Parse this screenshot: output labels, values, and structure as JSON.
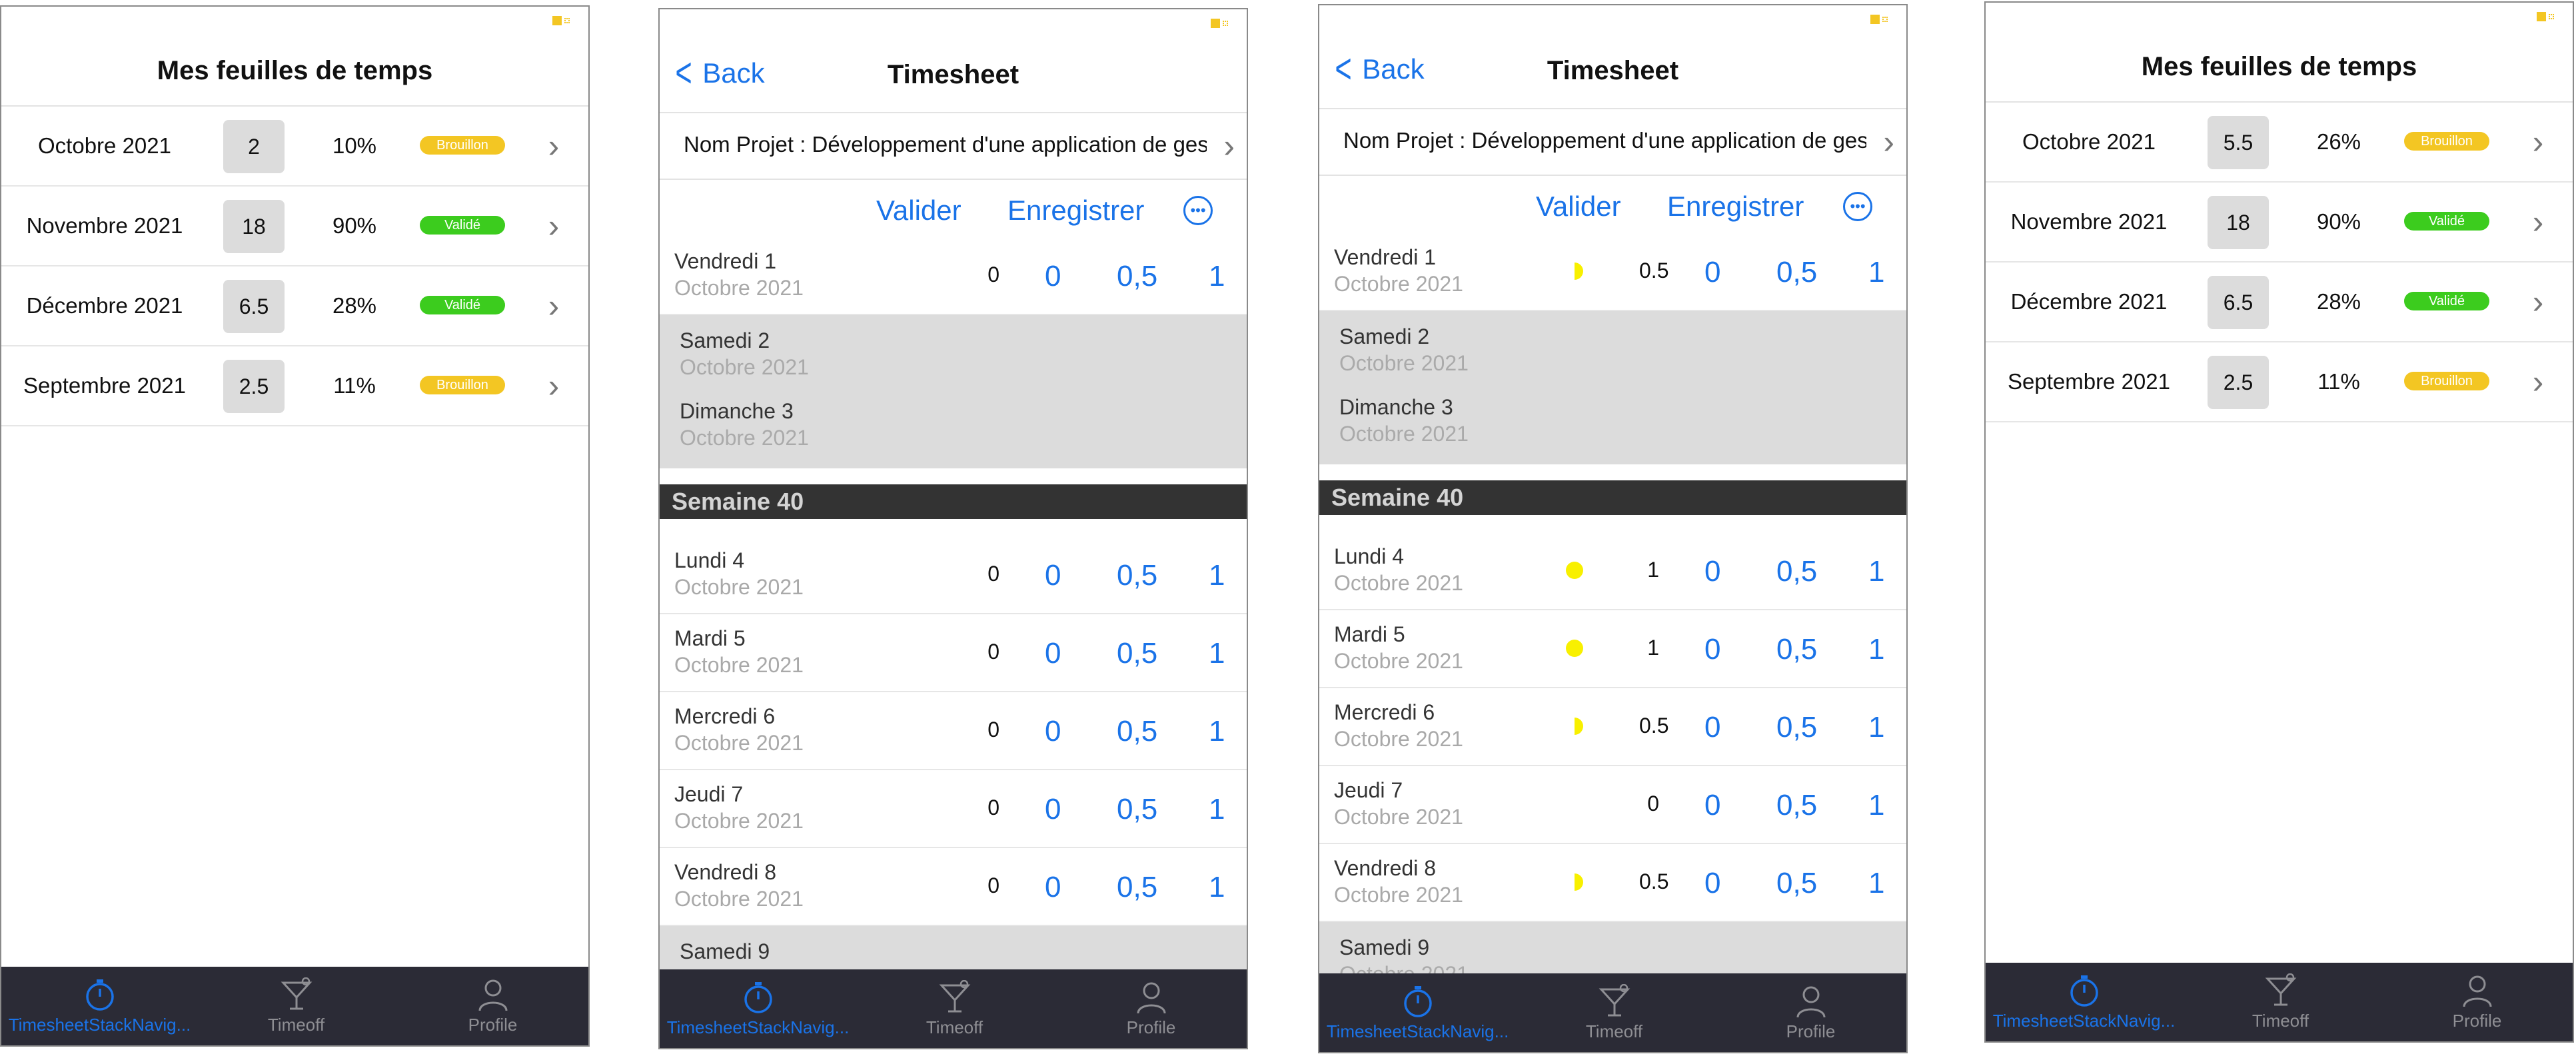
{
  "list_screen": {
    "title": "Mes feuilles de temps",
    "rows_a": [
      {
        "month": "Octobre 2021",
        "days": "2",
        "pct": "10%",
        "status": "Brouillon",
        "status_color": "#f3c623"
      },
      {
        "month": "Novembre 2021",
        "days": "18",
        "pct": "90%",
        "status": "Validé",
        "status_color": "#3ccc1e"
      },
      {
        "month": "Décembre 2021",
        "days": "6.5",
        "pct": "28%",
        "status": "Validé",
        "status_color": "#3ccc1e"
      },
      {
        "month": "Septembre 2021",
        "days": "2.5",
        "pct": "11%",
        "status": "Brouillon",
        "status_color": "#f3c623"
      }
    ],
    "rows_b": [
      {
        "month": "Octobre 2021",
        "days": "5.5",
        "pct": "26%",
        "status": "Brouillon",
        "status_color": "#f3c623"
      },
      {
        "month": "Novembre 2021",
        "days": "18",
        "pct": "90%",
        "status": "Validé",
        "status_color": "#3ccc1e"
      },
      {
        "month": "Décembre 2021",
        "days": "6.5",
        "pct": "28%",
        "status": "Validé",
        "status_color": "#3ccc1e"
      },
      {
        "month": "Septembre 2021",
        "days": "2.5",
        "pct": "11%",
        "status": "Brouillon",
        "status_color": "#f3c623"
      }
    ]
  },
  "timesheet": {
    "back": "Back",
    "title": "Timesheet",
    "project": "Nom Projet : Développement d'une application de gestion",
    "validate": "Valider",
    "save": "Enregistrer",
    "option_0": "0",
    "option_half": "0,5",
    "option_1": "1",
    "week_label": "Semaine 40",
    "month_label": "Octobre 2021",
    "days_a": [
      {
        "name": "Vendredi 1",
        "value": "0",
        "indicator": "none"
      },
      {
        "name": "Lundi 4",
        "value": "0",
        "indicator": "none"
      },
      {
        "name": "Mardi 5",
        "value": "0",
        "indicator": "none"
      },
      {
        "name": "Mercredi 6",
        "value": "0",
        "indicator": "none"
      },
      {
        "name": "Jeudi 7",
        "value": "0",
        "indicator": "none"
      },
      {
        "name": "Vendredi 8",
        "value": "0",
        "indicator": "none"
      }
    ],
    "days_b": [
      {
        "name": "Vendredi 1",
        "value": "0.5",
        "indicator": "half"
      },
      {
        "name": "Lundi 4",
        "value": "1",
        "indicator": "full"
      },
      {
        "name": "Mardi 5",
        "value": "1",
        "indicator": "full"
      },
      {
        "name": "Mercredi 6",
        "value": "0.5",
        "indicator": "half"
      },
      {
        "name": "Jeudi 7",
        "value": "0",
        "indicator": "none"
      },
      {
        "name": "Vendredi 8",
        "value": "0.5",
        "indicator": "half"
      }
    ],
    "weekend": [
      "Samedi 2",
      "Dimanche 3"
    ],
    "weekend_next": "Samedi 9"
  },
  "tabbar": {
    "tab1": "TimesheetStackNavig...",
    "tab2": "Timeoff",
    "tab3": "Profile",
    "active_color": "#1a73e8"
  }
}
